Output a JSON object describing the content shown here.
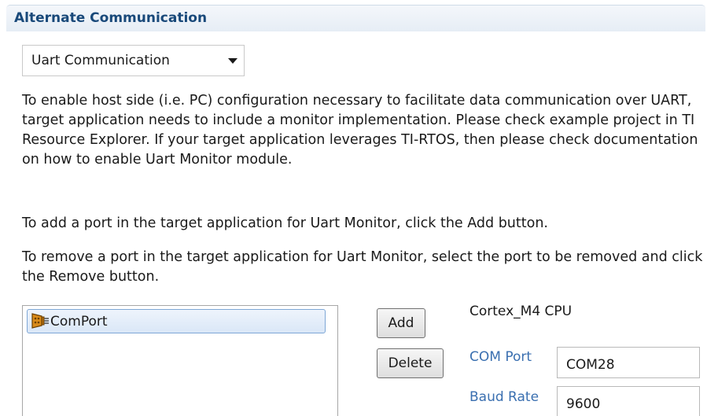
{
  "section": {
    "title": "Alternate Communication"
  },
  "mode_select": {
    "selected": "Uart Communication",
    "arrow_icon": "chevron-down-icon"
  },
  "description": {
    "paragraph1": "To enable host side (i.e. PC) configuration necessary to facilitate data communication over UART, target application needs to include a monitor implementation. Please check example project in TI Resource Explorer. If your target application leverages TI-RTOS, then please check documentation on how to enable Uart Monitor module.",
    "paragraph2": "To add a port in the target application for Uart Monitor, click the Add button.",
    "paragraph3": "To remove a port in the target application for Uart Monitor, select the port to be removed and click the Remove button."
  },
  "ports": {
    "items": [
      {
        "label": "ComPort",
        "icon": "serial-port-icon",
        "selected": true
      }
    ]
  },
  "buttons": {
    "add_label": "Add",
    "delete_label": "Delete"
  },
  "target": {
    "name": "Cortex_M4 CPU",
    "com_port_label": "COM Port",
    "com_port_value": "COM28",
    "baud_rate_label": "Baud Rate",
    "baud_rate_value": "9600"
  },
  "colors": {
    "header_title": "#19497a",
    "field_label": "#3a6fb0",
    "selection_border": "#7ea7d6"
  }
}
